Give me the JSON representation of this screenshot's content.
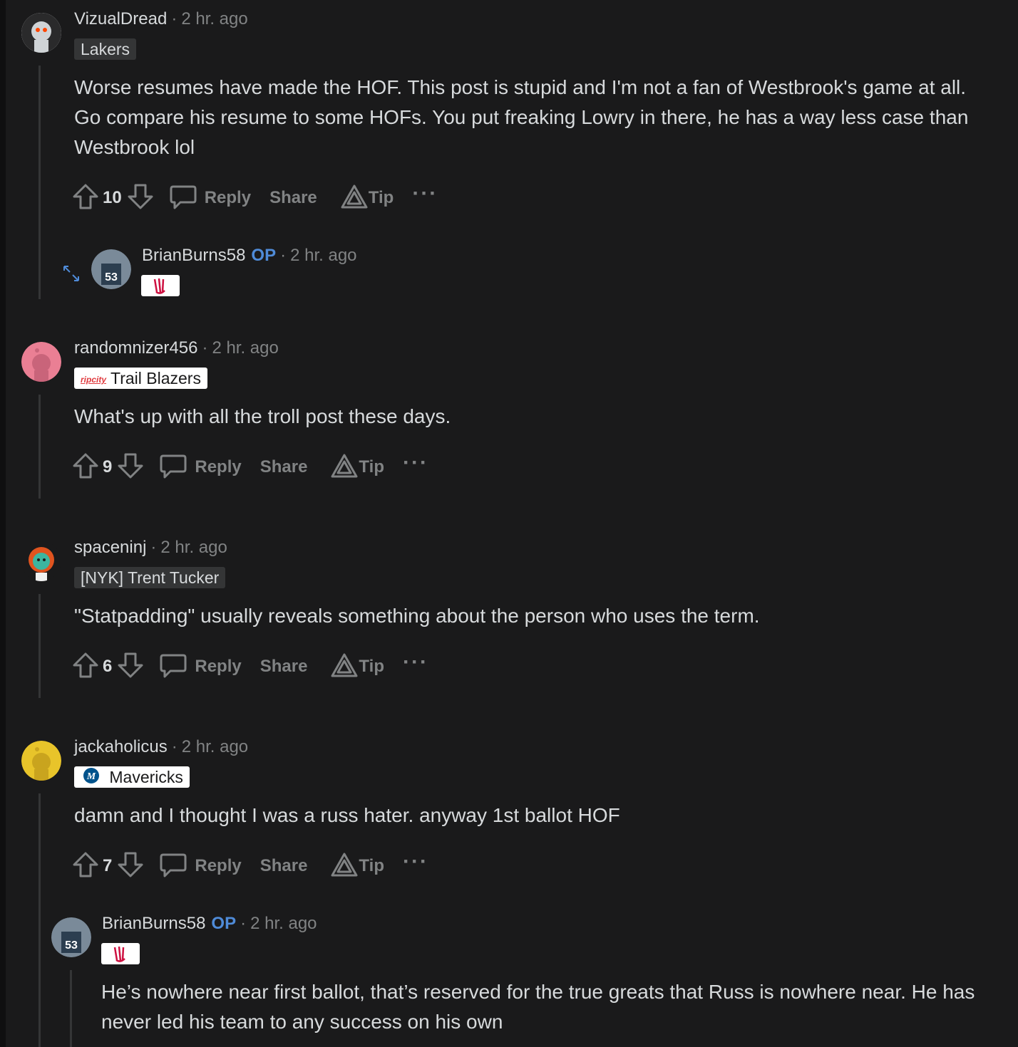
{
  "comments": [
    {
      "username": "VizualDread",
      "time": "2 hr. ago",
      "flair": "Lakers",
      "body": "Worse resumes have made the HOF. This post is stupid and I'm not a fan of Westbrook's game at all. Go compare his resume to some HOFs. You put freaking Lowry in there, he has a way less case than Westbrook lol",
      "score": "10",
      "reply": "Reply",
      "share": "Share",
      "tip": "Tip",
      "more": "···"
    },
    {
      "username": "BrianBurns58",
      "op": "OP",
      "time": "2 hr. ago"
    },
    {
      "username": "randomnizer456",
      "time": "2 hr. ago",
      "flair_logo": "ripcity",
      "flair": "Trail Blazers",
      "body": "What's up with all the troll post these days.",
      "score": "9",
      "reply": "Reply",
      "share": "Share",
      "tip": "Tip",
      "more": "···"
    },
    {
      "username": "spaceninj",
      "time": "2 hr. ago",
      "flair": "[NYK] Trent Tucker",
      "body": "\"Statpadding\" usually reveals something about the person who uses the term.",
      "score": "6",
      "reply": "Reply",
      "share": "Share",
      "tip": "Tip",
      "more": "···"
    },
    {
      "username": "jackaholicus",
      "time": "2 hr. ago",
      "flair": "Mavericks",
      "body": "damn and I thought I was a russ hater. anyway 1st ballot HOF",
      "score": "7",
      "reply": "Reply",
      "share": "Share",
      "tip": "Tip",
      "more": "···"
    },
    {
      "username": "BrianBurns58",
      "op": "OP",
      "time": "2 hr. ago",
      "body": "He’s nowhere near first ballot, that’s reserved for the true greats that Russ is nowhere near. He has never led his team to any success on his own"
    }
  ],
  "colors": {
    "background": "#1a1a1b",
    "text": "#d7dadc",
    "muted": "#818384",
    "op": "#4f8bd8",
    "flair_dark": "#343536"
  }
}
